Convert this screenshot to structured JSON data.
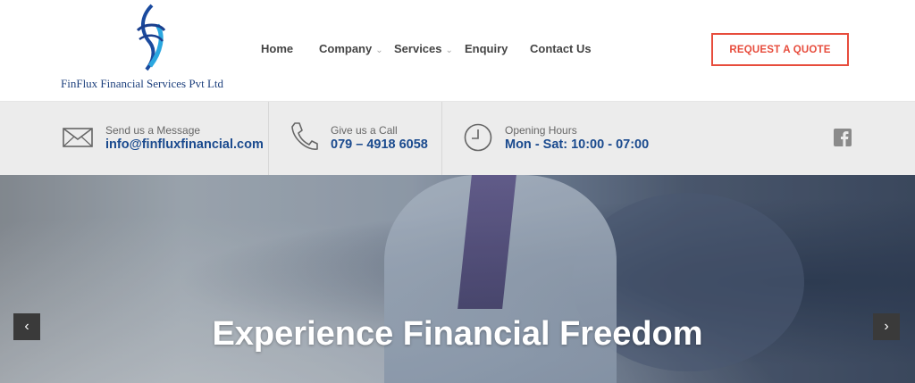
{
  "header": {
    "company_name": "FinFlux Financial Services Pvt Ltd",
    "nav": [
      {
        "label": "Home",
        "has_dropdown": false
      },
      {
        "label": "Company",
        "has_dropdown": true
      },
      {
        "label": "Services",
        "has_dropdown": true
      },
      {
        "label": "Enquiry",
        "has_dropdown": false
      },
      {
        "label": "Contact Us",
        "has_dropdown": false
      }
    ],
    "cta_label": "REQUEST A QUOTE"
  },
  "infobar": {
    "email": {
      "label": "Send us a Message",
      "value": "info@finfluxfinancial.com",
      "icon": "envelope-icon"
    },
    "phone": {
      "label": "Give us a Call",
      "value": "079 – 4918 6058",
      "icon": "phone-icon"
    },
    "hours": {
      "label": "Opening Hours",
      "value": "Mon - Sat: 10:00 - 07:00",
      "icon": "clock-icon"
    },
    "social": {
      "icon": "facebook-icon"
    }
  },
  "hero": {
    "title": "Experience Financial Freedom",
    "prev_icon": "chevron-left-icon",
    "next_icon": "chevron-right-icon"
  },
  "colors": {
    "accent": "#e74c3c",
    "brand_blue": "#1a4a8e",
    "nav_text": "#444444"
  }
}
